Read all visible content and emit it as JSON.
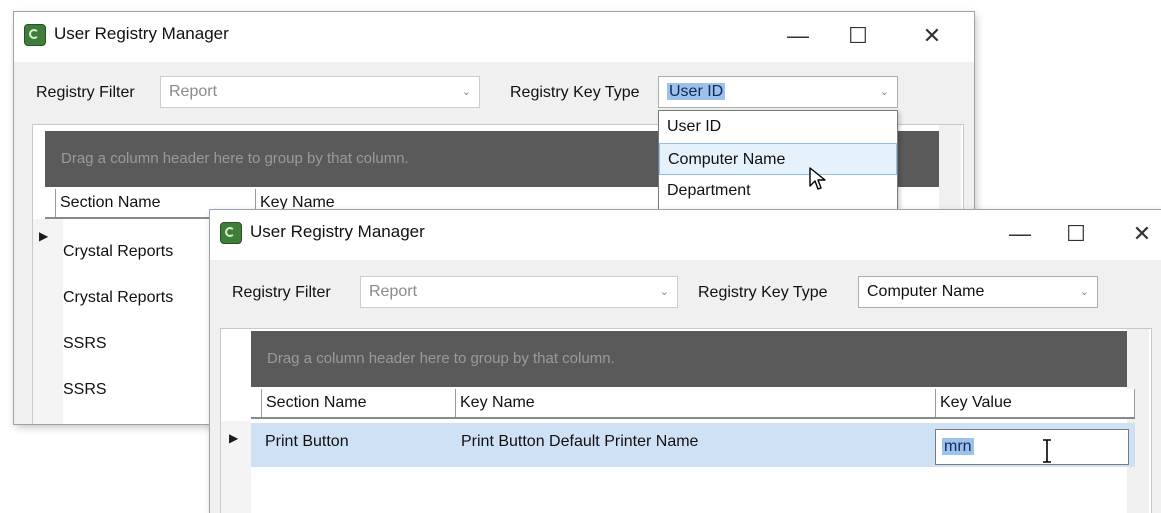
{
  "back_window": {
    "title": "User Registry Manager",
    "controls": {
      "minimize": "—",
      "maximize": "☐",
      "close": "✕"
    },
    "registry_filter_label": "Registry Filter",
    "registry_filter_value": "Report",
    "registry_key_type_label": "Registry Key Type",
    "registry_key_type_value": "User ID",
    "dropdown_options": [
      "User ID",
      "Computer Name",
      "Department"
    ],
    "group_panel_text": "Drag a column header here to group by that column.",
    "columns": {
      "section_name": "Section Name",
      "key_name": "Key Name"
    },
    "rows": [
      "Crystal Reports",
      "Crystal Reports",
      "SSRS",
      "SSRS"
    ]
  },
  "front_window": {
    "title": "User Registry Manager",
    "controls": {
      "minimize": "—",
      "maximize": "☐",
      "close": "✕"
    },
    "registry_filter_label": "Registry Filter",
    "registry_filter_value": "Report",
    "registry_key_type_label": "Registry Key Type",
    "registry_key_type_value": "Computer Name",
    "group_panel_text": "Drag a column header here to group by that column.",
    "columns": {
      "section_name": "Section Name",
      "key_name": "Key Name",
      "key_value": "Key Value"
    },
    "rows": [
      {
        "section_name": "Print Button",
        "key_name": "Print Button Default Printer Name",
        "key_value": "mrn"
      }
    ]
  },
  "colors": {
    "group_panel": "#5a5a5a",
    "row_selected": "#cfe1f5",
    "selection": "#9ec1ea",
    "app_icon": "#3f7d3a"
  },
  "icons": {
    "app": "registry-app-icon",
    "cursor_pointer": "arrow-cursor-icon",
    "cursor_text": "ibeam-cursor-icon",
    "current_row": "row-pointer-icon"
  }
}
